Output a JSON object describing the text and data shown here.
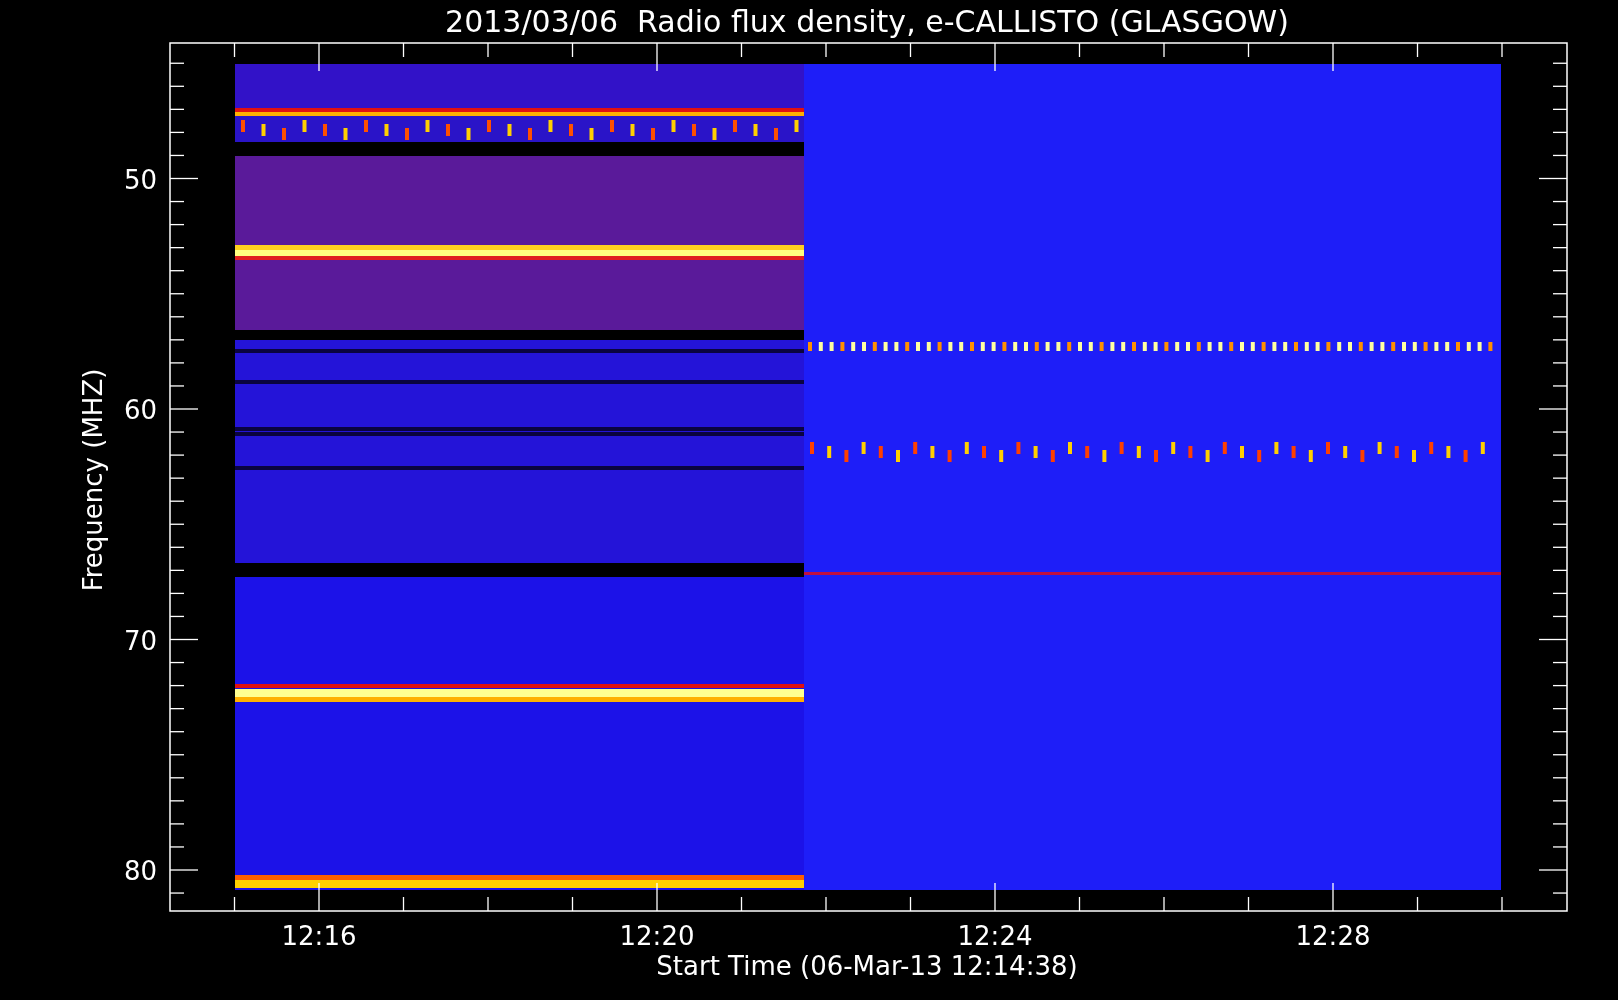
{
  "plot": {
    "title": "2013/03/06  Radio flux density, e-CALLISTO (GLASGOW)",
    "y_axis": {
      "label": "Frequency (MHZ)",
      "ticks": [
        "50",
        "60",
        "70",
        "80"
      ]
    },
    "x_axis": {
      "label": "Start Time (06-Mar-13 12:14:38)",
      "ticks": [
        "12:16",
        "12:20",
        "12:24",
        "12:28"
      ]
    }
  }
}
